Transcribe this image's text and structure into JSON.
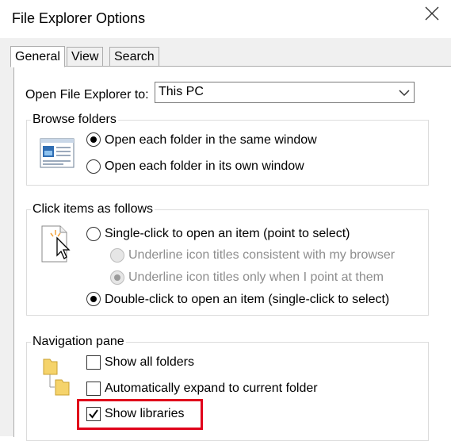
{
  "window": {
    "title": "File Explorer Options"
  },
  "tabs": [
    {
      "label": "General",
      "active": true
    },
    {
      "label": "View",
      "active": false
    },
    {
      "label": "Search",
      "active": false
    }
  ],
  "open_to": {
    "label": "Open File Explorer to:",
    "value": "This PC"
  },
  "browse_folders": {
    "title": "Browse folders",
    "options": [
      {
        "label": "Open each folder in the same window",
        "selected": true
      },
      {
        "label": "Open each folder in its own window",
        "selected": false
      }
    ]
  },
  "click_items": {
    "title": "Click items as follows",
    "single_click": {
      "label": "Single-click to open an item (point to select)",
      "selected": false
    },
    "underline_browser": {
      "label": "Underline icon titles consistent with my browser",
      "selected": false,
      "enabled": false
    },
    "underline_point": {
      "label": "Underline icon titles only when I point at them",
      "selected": true,
      "enabled": false
    },
    "double_click": {
      "label": "Double-click to open an item (single-click to select)",
      "selected": true
    }
  },
  "navigation_pane": {
    "title": "Navigation pane",
    "show_all_folders": {
      "label": "Show all folders",
      "checked": false
    },
    "auto_expand": {
      "label": "Automatically expand to current folder",
      "checked": false
    },
    "show_libraries": {
      "label": "Show libraries",
      "checked": true
    }
  },
  "colors": {
    "highlight": "#e0001a",
    "folder": "#f5d36b",
    "disabled_text": "#8d8d8d"
  },
  "icons": [
    "close-icon",
    "chevron-down-icon",
    "browse-folders-icon",
    "pointer-click-icon",
    "folder-icon"
  ]
}
